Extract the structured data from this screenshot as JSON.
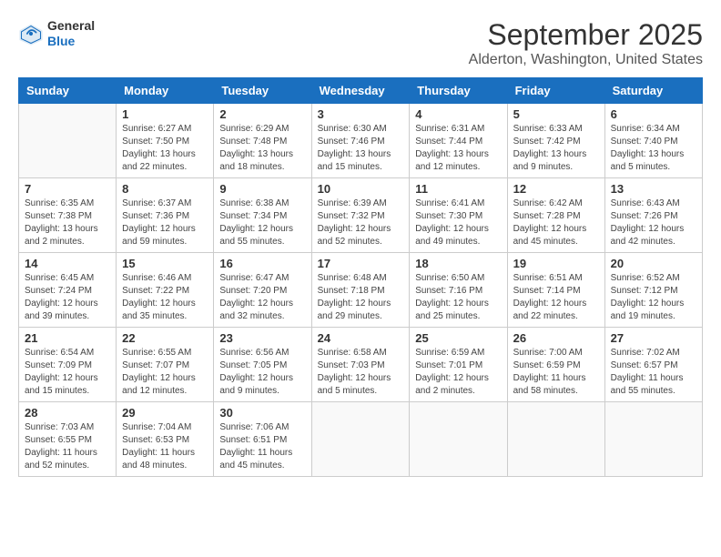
{
  "header": {
    "logo_general": "General",
    "logo_blue": "Blue",
    "title": "September 2025",
    "subtitle": "Alderton, Washington, United States"
  },
  "weekdays": [
    "Sunday",
    "Monday",
    "Tuesday",
    "Wednesday",
    "Thursday",
    "Friday",
    "Saturday"
  ],
  "weeks": [
    [
      {
        "day": "",
        "info": ""
      },
      {
        "day": "1",
        "info": "Sunrise: 6:27 AM\nSunset: 7:50 PM\nDaylight: 13 hours\nand 22 minutes."
      },
      {
        "day": "2",
        "info": "Sunrise: 6:29 AM\nSunset: 7:48 PM\nDaylight: 13 hours\nand 18 minutes."
      },
      {
        "day": "3",
        "info": "Sunrise: 6:30 AM\nSunset: 7:46 PM\nDaylight: 13 hours\nand 15 minutes."
      },
      {
        "day": "4",
        "info": "Sunrise: 6:31 AM\nSunset: 7:44 PM\nDaylight: 13 hours\nand 12 minutes."
      },
      {
        "day": "5",
        "info": "Sunrise: 6:33 AM\nSunset: 7:42 PM\nDaylight: 13 hours\nand 9 minutes."
      },
      {
        "day": "6",
        "info": "Sunrise: 6:34 AM\nSunset: 7:40 PM\nDaylight: 13 hours\nand 5 minutes."
      }
    ],
    [
      {
        "day": "7",
        "info": "Sunrise: 6:35 AM\nSunset: 7:38 PM\nDaylight: 13 hours\nand 2 minutes."
      },
      {
        "day": "8",
        "info": "Sunrise: 6:37 AM\nSunset: 7:36 PM\nDaylight: 12 hours\nand 59 minutes."
      },
      {
        "day": "9",
        "info": "Sunrise: 6:38 AM\nSunset: 7:34 PM\nDaylight: 12 hours\nand 55 minutes."
      },
      {
        "day": "10",
        "info": "Sunrise: 6:39 AM\nSunset: 7:32 PM\nDaylight: 12 hours\nand 52 minutes."
      },
      {
        "day": "11",
        "info": "Sunrise: 6:41 AM\nSunset: 7:30 PM\nDaylight: 12 hours\nand 49 minutes."
      },
      {
        "day": "12",
        "info": "Sunrise: 6:42 AM\nSunset: 7:28 PM\nDaylight: 12 hours\nand 45 minutes."
      },
      {
        "day": "13",
        "info": "Sunrise: 6:43 AM\nSunset: 7:26 PM\nDaylight: 12 hours\nand 42 minutes."
      }
    ],
    [
      {
        "day": "14",
        "info": "Sunrise: 6:45 AM\nSunset: 7:24 PM\nDaylight: 12 hours\nand 39 minutes."
      },
      {
        "day": "15",
        "info": "Sunrise: 6:46 AM\nSunset: 7:22 PM\nDaylight: 12 hours\nand 35 minutes."
      },
      {
        "day": "16",
        "info": "Sunrise: 6:47 AM\nSunset: 7:20 PM\nDaylight: 12 hours\nand 32 minutes."
      },
      {
        "day": "17",
        "info": "Sunrise: 6:48 AM\nSunset: 7:18 PM\nDaylight: 12 hours\nand 29 minutes."
      },
      {
        "day": "18",
        "info": "Sunrise: 6:50 AM\nSunset: 7:16 PM\nDaylight: 12 hours\nand 25 minutes."
      },
      {
        "day": "19",
        "info": "Sunrise: 6:51 AM\nSunset: 7:14 PM\nDaylight: 12 hours\nand 22 minutes."
      },
      {
        "day": "20",
        "info": "Sunrise: 6:52 AM\nSunset: 7:12 PM\nDaylight: 12 hours\nand 19 minutes."
      }
    ],
    [
      {
        "day": "21",
        "info": "Sunrise: 6:54 AM\nSunset: 7:09 PM\nDaylight: 12 hours\nand 15 minutes."
      },
      {
        "day": "22",
        "info": "Sunrise: 6:55 AM\nSunset: 7:07 PM\nDaylight: 12 hours\nand 12 minutes."
      },
      {
        "day": "23",
        "info": "Sunrise: 6:56 AM\nSunset: 7:05 PM\nDaylight: 12 hours\nand 9 minutes."
      },
      {
        "day": "24",
        "info": "Sunrise: 6:58 AM\nSunset: 7:03 PM\nDaylight: 12 hours\nand 5 minutes."
      },
      {
        "day": "25",
        "info": "Sunrise: 6:59 AM\nSunset: 7:01 PM\nDaylight: 12 hours\nand 2 minutes."
      },
      {
        "day": "26",
        "info": "Sunrise: 7:00 AM\nSunset: 6:59 PM\nDaylight: 11 hours\nand 58 minutes."
      },
      {
        "day": "27",
        "info": "Sunrise: 7:02 AM\nSunset: 6:57 PM\nDaylight: 11 hours\nand 55 minutes."
      }
    ],
    [
      {
        "day": "28",
        "info": "Sunrise: 7:03 AM\nSunset: 6:55 PM\nDaylight: 11 hours\nand 52 minutes."
      },
      {
        "day": "29",
        "info": "Sunrise: 7:04 AM\nSunset: 6:53 PM\nDaylight: 11 hours\nand 48 minutes."
      },
      {
        "day": "30",
        "info": "Sunrise: 7:06 AM\nSunset: 6:51 PM\nDaylight: 11 hours\nand 45 minutes."
      },
      {
        "day": "",
        "info": ""
      },
      {
        "day": "",
        "info": ""
      },
      {
        "day": "",
        "info": ""
      },
      {
        "day": "",
        "info": ""
      }
    ]
  ]
}
